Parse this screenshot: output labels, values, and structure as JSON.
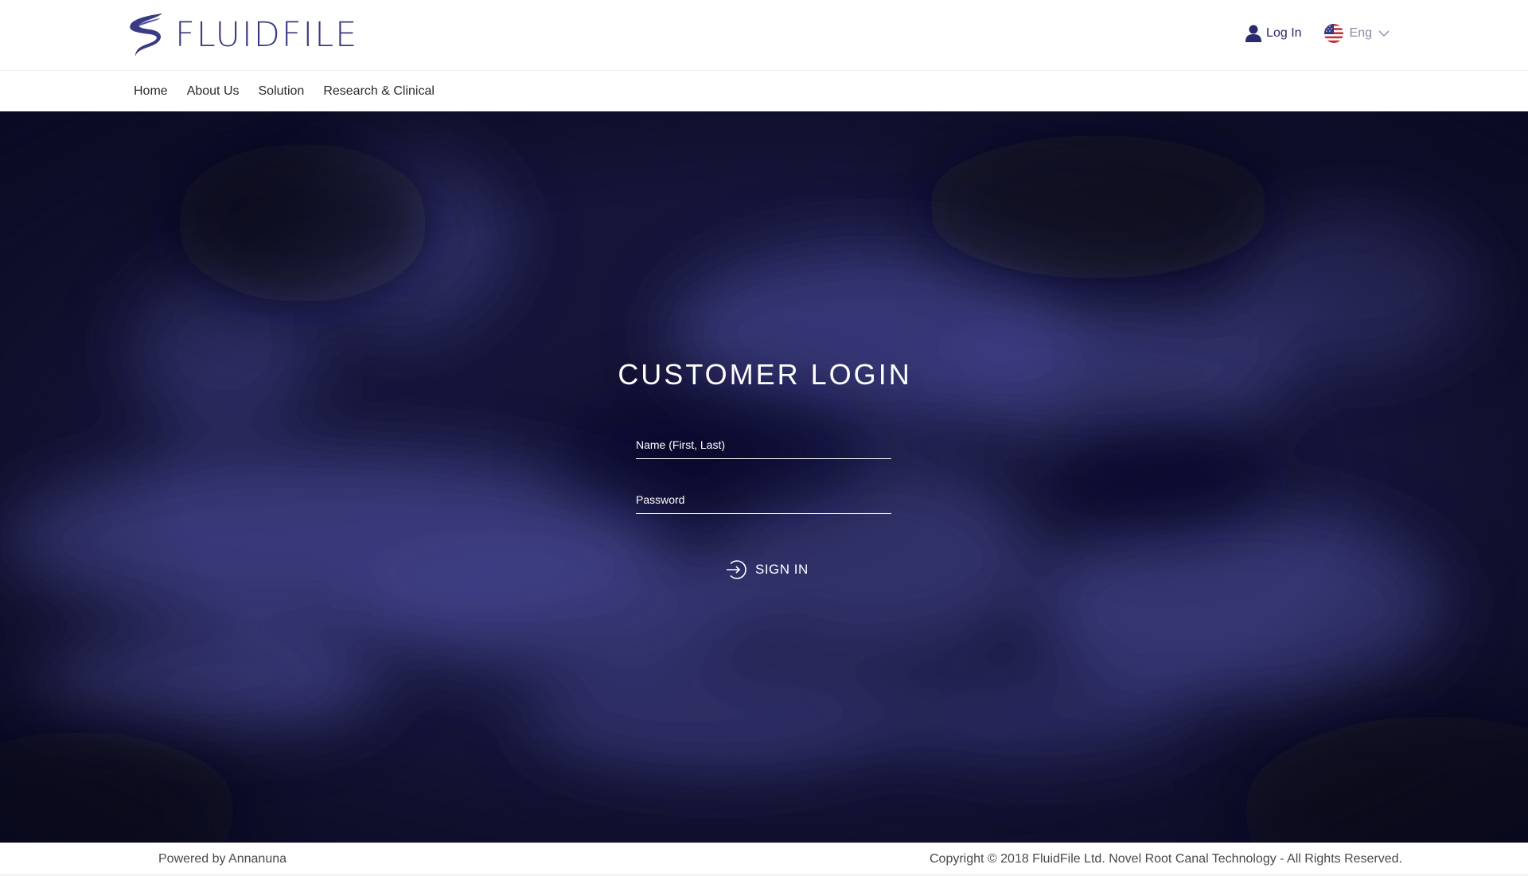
{
  "brand": {
    "name": "FLUIDFILE",
    "color": "#3a3a84"
  },
  "header": {
    "login_label": "Log In",
    "login_icon": "user-icon",
    "language": {
      "selected": "Eng",
      "flag_icon": "us-flag-icon"
    }
  },
  "nav": {
    "items": [
      {
        "label": "Home"
      },
      {
        "label": "About Us"
      },
      {
        "label": "Solution"
      },
      {
        "label": "Research & Clinical"
      }
    ]
  },
  "login": {
    "title": "CUSTOMER LOGIN",
    "name_placeholder": "Name (First, Last)",
    "password_placeholder": "Password",
    "submit_label": "SIGN IN",
    "submit_icon": "sign-in-icon"
  },
  "footer": {
    "left_text": "Powered by Annanuna",
    "right_text": "Copyright © 2018 FluidFile Ltd. Novel Root Canal Technology - All Rights Reserved."
  },
  "colors": {
    "hero_dark": "#14142e",
    "hero_light": "#45458a",
    "text_white": "#ffffff"
  }
}
